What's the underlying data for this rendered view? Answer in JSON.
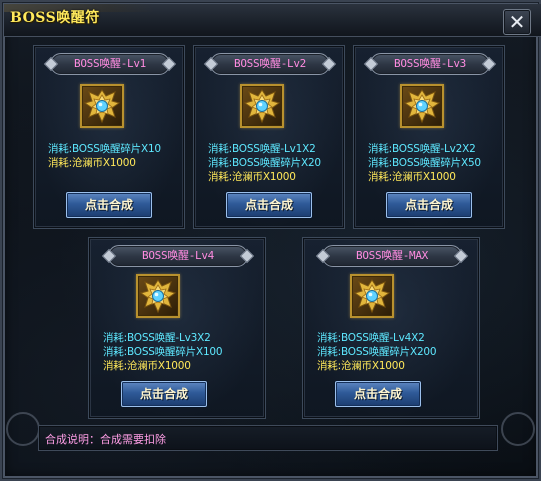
{
  "window": {
    "title": "BOSS唤醒符",
    "close_label": "✕"
  },
  "panels": [
    {
      "title": "BOSS唤醒-Lv1",
      "costs": [
        "消耗:BOSS唤醒碎片X10",
        "消耗:沧澜币X1000"
      ],
      "button": "点击合成"
    },
    {
      "title": "BOSS唤醒-Lv2",
      "costs": [
        "消耗:BOSS唤醒-Lv1X2",
        "消耗:BOSS唤醒碎片X20",
        "消耗:沧澜币X1000"
      ],
      "button": "点击合成"
    },
    {
      "title": "BOSS唤醒-Lv3",
      "costs": [
        "消耗:BOSS唤醒-Lv2X2",
        "消耗:BOSS唤醒碎片X50",
        "消耗:沧澜币X1000"
      ],
      "button": "点击合成"
    },
    {
      "title": "BOSS唤醒-Lv4",
      "costs": [
        "消耗:BOSS唤醒-Lv3X2",
        "消耗:BOSS唤醒碎片X100",
        "消耗:沧澜币X1000"
      ],
      "button": "点击合成"
    },
    {
      "title": "BOSS唤醒-MAX",
      "costs": [
        "消耗:BOSS唤醒-Lv4X2",
        "消耗:BOSS唤醒碎片X200",
        "消耗:沧澜币X1000"
      ],
      "button": "点击合成"
    }
  ],
  "note": "合成说明：合成需要扣除",
  "colors": {
    "title": "#ffe95c",
    "panel_title": "#ff8ce1",
    "cost_item": "#5ee8ff",
    "cost_currency": "#ffe85a",
    "note": "#ff9ee6"
  },
  "icons": {
    "item": "golden-winged-emblem-icon",
    "close": "close-icon"
  }
}
